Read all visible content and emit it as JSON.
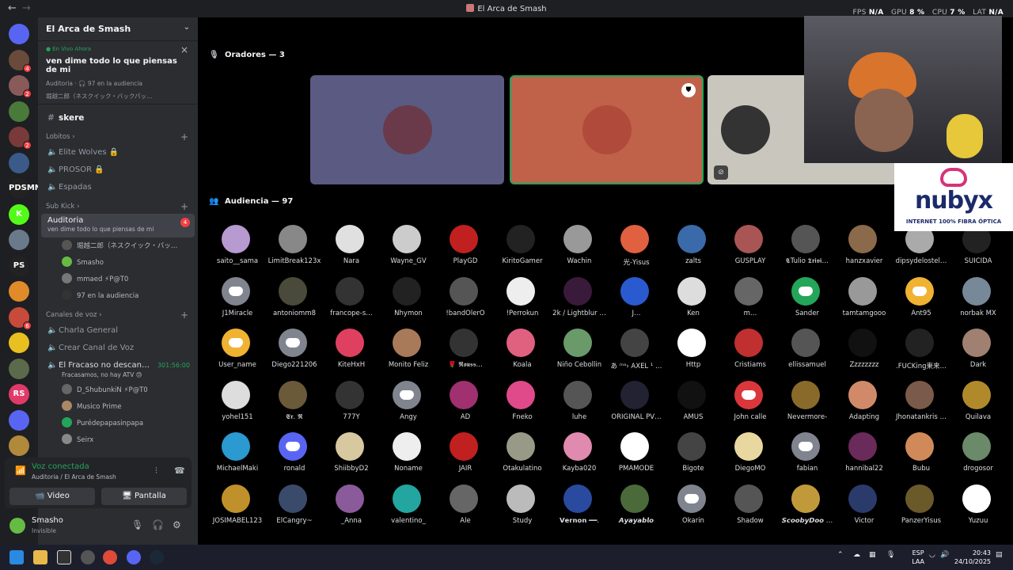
{
  "window": {
    "title": "El Arca de Smash",
    "back": "←",
    "forward": "→"
  },
  "perf": {
    "fps_label": "FPS",
    "fps": "N/A",
    "gpu_label": "GPU",
    "gpu": "8 %",
    "cpu_label": "CPU",
    "cpu": "7 %",
    "lat_label": "LAT",
    "lat": "N/A"
  },
  "rail": {
    "servers": [
      {
        "name": "discord-home",
        "color": "#5865f2",
        "label": ""
      },
      {
        "name": "server-1",
        "color": "#6a4a3a",
        "badge": "4"
      },
      {
        "name": "server-2",
        "color": "#8a5a5a",
        "badge": "2"
      },
      {
        "name": "server-3",
        "color": "#4a7a3a"
      },
      {
        "name": "server-4",
        "color": "#7a3a3a",
        "badge": "2"
      },
      {
        "name": "server-5",
        "color": "#3a5a8a"
      },
      {
        "name": "server-6",
        "color": "#222",
        "label": "PDSMN"
      },
      {
        "name": "server-7",
        "color": "#53fc18",
        "label": "K"
      },
      {
        "name": "server-8",
        "color": "#6a7a8a"
      },
      {
        "name": "server-9",
        "color": "#222",
        "label": "PS"
      },
      {
        "name": "server-10",
        "color": "#e08a2a"
      },
      {
        "name": "server-11",
        "color": "#c84a3a",
        "badge": "6"
      },
      {
        "name": "server-12",
        "color": "#e8c020"
      },
      {
        "name": "server-13",
        "color": "#5a6a4a"
      },
      {
        "name": "server-14",
        "color": "#e03a6a",
        "label": "RS"
      },
      {
        "name": "server-15",
        "color": "#5865f2"
      },
      {
        "name": "server-16",
        "color": "#b08a3a"
      }
    ]
  },
  "sidebar": {
    "server_name": "El Arca de Smash",
    "live": {
      "tag": "En Vivo Ahora",
      "topic": "ven dime todo lo que piensas de mi",
      "meta": "Auditoria · 🎧 97 en la audiencia",
      "speakers": "堀越二郎（ネスクイック・バックパッ…"
    },
    "channels_top": [
      {
        "label": "skere"
      }
    ],
    "cat_lobitos": "Lobitos",
    "lobitos": [
      {
        "label": "Elite Wolves 🔒"
      },
      {
        "label": "PROSOR 🔒"
      },
      {
        "label": "Espadas"
      }
    ],
    "cat_subkick": "Sub Kick",
    "active": {
      "label": "Auditoria",
      "sub": "ven dime todo lo que piensas de mi",
      "badge": "4"
    },
    "stage_users": [
      {
        "name": "堀越二郎（ネスクイック・バッ…",
        "color": "#555"
      },
      {
        "name": "Smasho",
        "color": "#6b4"
      },
      {
        "name": "mmaed  ⚡P@T0",
        "color": "#777"
      },
      {
        "name": "97 en la audiencia",
        "color": "#333"
      }
    ],
    "cat_voice": "Canales de voz",
    "voice": [
      {
        "label": "Charla General"
      },
      {
        "label": "Crear Canal de Voz"
      }
    ],
    "fracaso": {
      "label": "El Fracaso no descan…",
      "time": "301:56:00",
      "sub": "Fracasamos, no hay ATV 😓"
    },
    "fracaso_users": [
      {
        "name": "D_ShubunkiN  ⚡P@T0",
        "color": "#666"
      },
      {
        "name": "Musico Prime",
        "color": "#a86"
      },
      {
        "name": "Purédepapasinpapa",
        "color": "#23a55a"
      },
      {
        "name": "Seirx",
        "color": "#888"
      }
    ]
  },
  "voice_panel": {
    "status": "Voz conectada",
    "path": "Auditoria / El Arca de Smash",
    "video": "Video",
    "screen": "Pantalla"
  },
  "user": {
    "name": "Smasho",
    "status": "Invisible"
  },
  "stage": {
    "speakers_header": "Oradores — 3",
    "audience_header": "Audiencia — 97",
    "speakers": [
      {
        "name": "speaker-1",
        "bg": "#5b5a82",
        "disc": "#6a3a4a"
      },
      {
        "name": "speaker-2",
        "bg": "#c0614a",
        "disc": "#b04a3a",
        "mod": "⛊"
      },
      {
        "name": "speaker-3",
        "bg": "#c9c7bd",
        "disc": "#333"
      }
    ],
    "audience": [
      {
        "n": "saito__sama",
        "c": "#b69ad0"
      },
      {
        "n": "LimitBreak123x",
        "c": "#888"
      },
      {
        "n": "Nara",
        "c": "#e0e0e0"
      },
      {
        "n": "Wayne_GV",
        "c": "#ccc"
      },
      {
        "n": "PlayGD",
        "c": "#c02020"
      },
      {
        "n": "KiritoGamer",
        "c": "#222"
      },
      {
        "n": "Wachin",
        "c": "#999"
      },
      {
        "n": "光-Yisus",
        "c": "#e06040"
      },
      {
        "n": "zalts",
        "c": "#3a6aaa"
      },
      {
        "n": "GUSPLAY",
        "c": "#a55"
      },
      {
        "n": "𝕮Tulio 𝕿𝖗𝖎𝖛𝖎…",
        "c": "#555"
      },
      {
        "n": "hanzxavier",
        "c": "#8a6a4a"
      },
      {
        "n": "dipsydelostel…",
        "c": "#aaa"
      },
      {
        "n": "SUICIDA",
        "c": "#222"
      },
      {
        "n": "J1Miracle",
        "c": "#80848e",
        "d": 1
      },
      {
        "n": "antoniomm8",
        "c": "#4a4a3a"
      },
      {
        "n": "francope-s…",
        "c": "#333"
      },
      {
        "n": "Nhymon",
        "c": "#222"
      },
      {
        "n": "!bandOlerO",
        "c": "#555"
      },
      {
        "n": "!Perrokun",
        "c": "#eee"
      },
      {
        "n": "2k / Lightblur …",
        "c": "#3a1a3a"
      },
      {
        "n": "J…",
        "c": "#2a5acf"
      },
      {
        "n": "Ken",
        "c": "#ddd"
      },
      {
        "n": "m…",
        "c": "#666"
      },
      {
        "n": "Sander",
        "c": "#23a55a",
        "d": 1
      },
      {
        "n": "tamtamgooo",
        "c": "#999"
      },
      {
        "n": "Ant95",
        "c": "#f0b232",
        "d": 1
      },
      {
        "n": "norbak MX",
        "c": "#789"
      },
      {
        "n": "User_name",
        "c": "#f0b232",
        "d": 1
      },
      {
        "n": "Diego221206",
        "c": "#80848e",
        "d": 1
      },
      {
        "n": "KiteHxH",
        "c": "#e04060"
      },
      {
        "n": "Monito Feliz",
        "c": "#a87a5a"
      },
      {
        "n": "🌹 𝕽𝖔𝖚𝖘𝖘…",
        "c": "#333"
      },
      {
        "n": "Koala",
        "c": "#e06080"
      },
      {
        "n": "Niño Cebollin",
        "c": "#6a9a6a"
      },
      {
        "n": "あ ᵐᵃ› AXEL ¹ …",
        "c": "#444"
      },
      {
        "n": "Http",
        "c": "#fff"
      },
      {
        "n": "Cristiams",
        "c": "#c03030"
      },
      {
        "n": "ellissamuel",
        "c": "#555"
      },
      {
        "n": "Zzzzzzzz",
        "c": "#111"
      },
      {
        "n": ".FUCKing東来…",
        "c": "#222"
      },
      {
        "n": "Dark",
        "c": "#a08070"
      },
      {
        "n": "yohel151",
        "c": "#ddd"
      },
      {
        "n": "𝕰𝖗. 𝕽",
        "c": "#6a5a3a"
      },
      {
        "n": "777Y",
        "c": "#333"
      },
      {
        "n": "Angy",
        "c": "#80848e",
        "d": 1
      },
      {
        "n": "AD",
        "c": "#a03070"
      },
      {
        "n": "Fneko",
        "c": "#e04a8a"
      },
      {
        "n": "luhe",
        "c": "#555"
      },
      {
        "n": "ORIGINAL PV…",
        "c": "#223"
      },
      {
        "n": "AMUS",
        "c": "#111"
      },
      {
        "n": "John calle",
        "c": "#da373c",
        "d": 1
      },
      {
        "n": "Nevermore-",
        "c": "#8a6a2a"
      },
      {
        "n": "Adapting",
        "c": "#d08a6a"
      },
      {
        "n": "Jhonatankris …",
        "c": "#7a5a4a"
      },
      {
        "n": "Quilava",
        "c": "#b08a2a"
      },
      {
        "n": "MichaelMaki",
        "c": "#2a9ad0"
      },
      {
        "n": "ronald",
        "c": "#5865f2",
        "d": 1
      },
      {
        "n": "ShiibbyD2",
        "c": "#d8c8a0"
      },
      {
        "n": "Noname",
        "c": "#eee"
      },
      {
        "n": "JAIR",
        "c": "#c02020"
      },
      {
        "n": "Otakulatino",
        "c": "#998"
      },
      {
        "n": "Kayba020",
        "c": "#e08ab0"
      },
      {
        "n": "PMAMODE",
        "c": "#fff"
      },
      {
        "n": "Bigote",
        "c": "#444"
      },
      {
        "n": "DiegoMO",
        "c": "#e8d8a0"
      },
      {
        "n": "fabian",
        "c": "#80848e",
        "d": 1
      },
      {
        "n": "hannibal22",
        "c": "#6a2a5a"
      },
      {
        "n": "Bubu",
        "c": "#d08a5a"
      },
      {
        "n": "drogosor",
        "c": "#6a8a6a"
      },
      {
        "n": "JOSIMABEL123",
        "c": "#c0902a"
      },
      {
        "n": "ElCangry~",
        "c": "#3a4a6a"
      },
      {
        "n": "_Anna",
        "c": "#8a5a9a"
      },
      {
        "n": "valentino_",
        "c": "#23a5a0"
      },
      {
        "n": "Ale",
        "c": "#666"
      },
      {
        "n": "Study",
        "c": "#bbb"
      },
      {
        "n": "𝗩𝗲𝗿𝗻𝗼𝗻 ━━.",
        "c": "#2a4aa0"
      },
      {
        "n": "𝘼𝙮𝙖𝙮𝙖𝙗𝙡𝙤",
        "c": "#4a6a3a"
      },
      {
        "n": "Okarin",
        "c": "#80848e",
        "d": 1
      },
      {
        "n": "Shadow",
        "c": "#555"
      },
      {
        "n": "𝙎𝙘𝙤𝙤𝙗𝙮𝘿𝙤𝙤 …",
        "c": "#c09a3a"
      },
      {
        "n": "Victor",
        "c": "#2a3a6a"
      },
      {
        "n": "PanzerYisus",
        "c": "#6a5a2a"
      },
      {
        "n": "Yuzuu",
        "c": "#fff"
      }
    ]
  },
  "taskbar": {
    "lang1": "ESP",
    "lang2": "LAA",
    "time": "20:43",
    "date": "24/10/2025"
  }
}
